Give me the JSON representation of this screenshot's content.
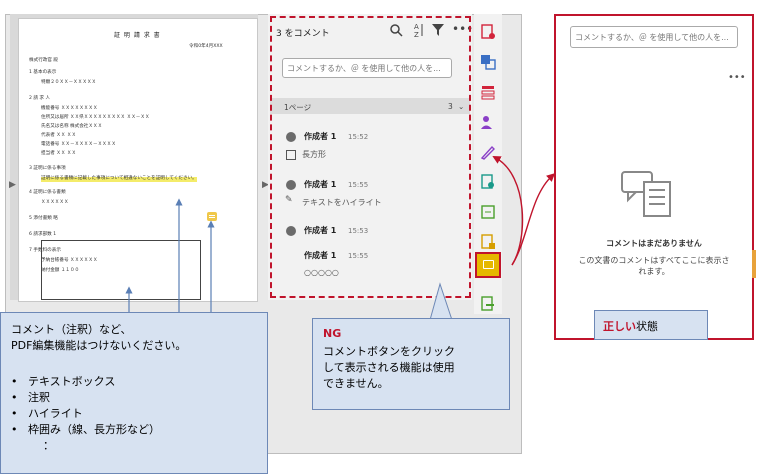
{
  "document": {
    "title": "証 明 請 求 書",
    "date": "令和0年4月XXX",
    "lines": [
      "株式行政官 殿",
      "1   基本の表示",
      "特願２０ＸＸ－ＸＸＸＸＸ",
      "2   請 求 人",
      "機能番号        ＸＸＸＸＸＸＸＸ",
      "住所又は居所    ＸＸ県ＸＸＸＸＸＸＸＸＸ  ＸＸ－ＸＸ",
      "氏名又は名称    株式会社ＸＸＸ",
      "代表者          ＸＸ  ＸＸ",
      "電話番号        ＸＸ－ＸＸＸＸ－ＸＸＸＸ",
      "担当者          ＸＸ  ＸＸ",
      "3   証明に係る事項",
      "証明に係る事項",
      "4   証明に係る書類",
      "ＸＸＸＸＸＸ",
      "5   添付書類    略",
      "6   請求部数    1",
      "7   手数料の表示",
      "予納台帳番号    ＸＸＸＸＸＸ",
      "納付金額        １１００"
    ],
    "highlight_text": "証明に係る書類に記載した事項について相違ないことを証明してください。"
  },
  "panel": {
    "title": "3 をコメント",
    "input_placeholder": "コメントするか、＠ を使用して他の人を...",
    "page_label": "1ページ",
    "page_count": "3",
    "comments": [
      {
        "author": "作成者 1",
        "time": "15:52",
        "body": "長方形",
        "icon": "rectangle-icon"
      },
      {
        "author": "作成者 1",
        "time": "15:55",
        "body": "テキストをハイライト",
        "icon": "highlight-icon"
      },
      {
        "author": "作成者 1",
        "time": "15:53",
        "body": "",
        "icon": "note-icon"
      },
      {
        "author": "作成者 1",
        "time": "15:55",
        "body": "○○○○○",
        "icon": ""
      }
    ]
  },
  "callouts": {
    "left": {
      "line1": "コメント（注釈）など、",
      "line2": "PDF編集機能はつけないください。",
      "items": [
        "テキストボックス",
        "注釈",
        "ハイライト",
        "枠囲み（線、長方形など）"
      ],
      "ellipsis": "："
    },
    "middle": {
      "label": "NG",
      "text1": "コメントボタンをクリック",
      "text2": "して表示される機能は使用",
      "text3": "できません。"
    },
    "right": {
      "strong": "正しい",
      "rest": "状態"
    }
  },
  "correct_panel": {
    "input_placeholder": "コメントするか、＠ を使用して他の人を...",
    "empty_title": "コメントはまだありません",
    "empty_body": "この文書のコメントはすべてここに表示されます。"
  },
  "colors": {
    "accent_red": "#c0142c",
    "comment_button": "#e6b800",
    "callout_fill": "#d7e2f1",
    "callout_border": "#6d88b6"
  }
}
